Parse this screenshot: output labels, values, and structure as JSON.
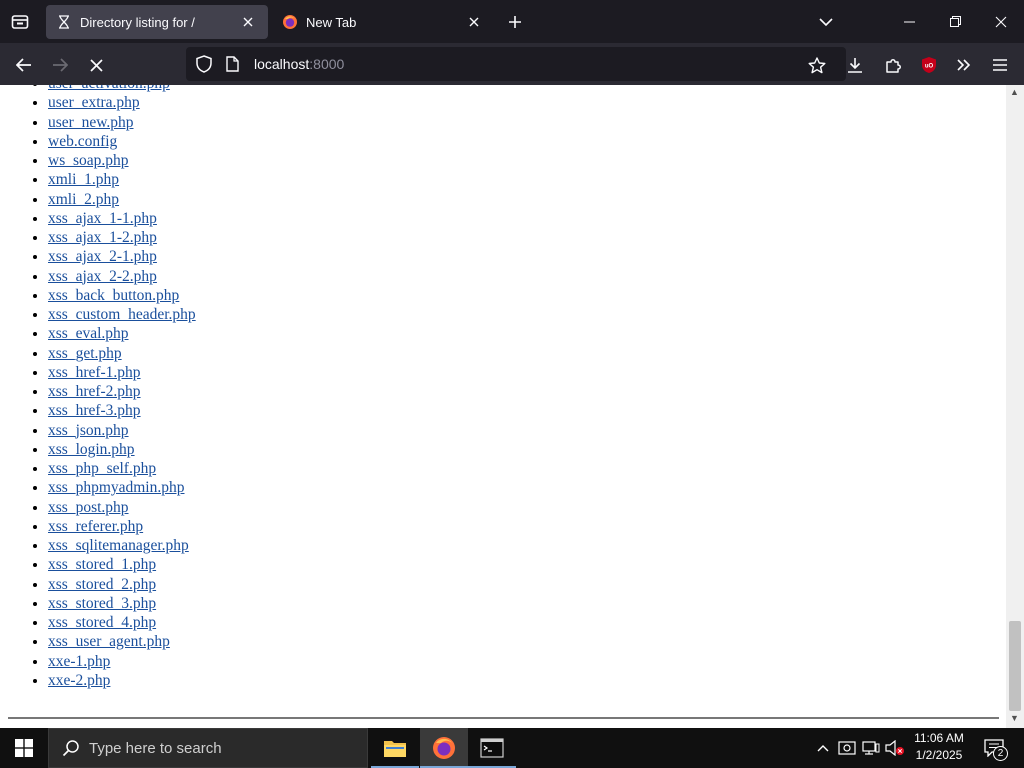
{
  "browser": {
    "tabs": [
      {
        "title": "Directory listing for /",
        "active": true,
        "loading": true
      },
      {
        "title": "New Tab",
        "active": false,
        "loading": false
      }
    ],
    "url": {
      "host": "localhost",
      "port": ":8000"
    }
  },
  "page": {
    "files": [
      "user_activation.php",
      "user_extra.php",
      "user_new.php",
      "web.config",
      "ws_soap.php",
      "xmli_1.php",
      "xmli_2.php",
      "xss_ajax_1-1.php",
      "xss_ajax_1-2.php",
      "xss_ajax_2-1.php",
      "xss_ajax_2-2.php",
      "xss_back_button.php",
      "xss_custom_header.php",
      "xss_eval.php",
      "xss_get.php",
      "xss_href-1.php",
      "xss_href-2.php",
      "xss_href-3.php",
      "xss_json.php",
      "xss_login.php",
      "xss_php_self.php",
      "xss_phpmyadmin.php",
      "xss_post.php",
      "xss_referer.php",
      "xss_sqlitemanager.php",
      "xss_stored_1.php",
      "xss_stored_2.php",
      "xss_stored_3.php",
      "xss_stored_4.php",
      "xss_user_agent.php",
      "xxe-1.php",
      "xxe-2.php"
    ]
  },
  "taskbar": {
    "search_placeholder": "Type here to search",
    "clock_time": "11:06 AM",
    "clock_date": "1/2/2025",
    "notification_count": "2"
  },
  "colors": {
    "link": "#1a4f9c",
    "tab_active": "#42414d",
    "toolbar": "#2b2a33",
    "tabstrip": "#1c1b22",
    "taskbar": "#101010"
  }
}
